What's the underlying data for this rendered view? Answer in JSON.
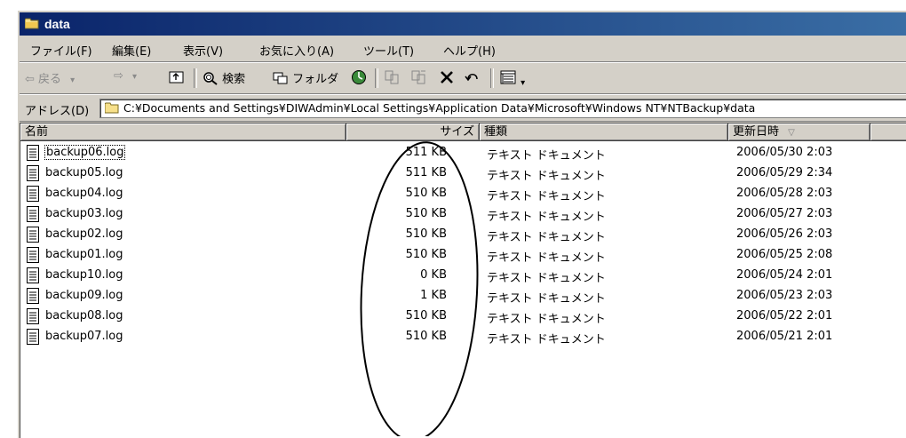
{
  "window": {
    "title": "data"
  },
  "menu": [
    {
      "label": "ファイル(F)"
    },
    {
      "label": "編集(E)"
    },
    {
      "label": "表示(V)"
    },
    {
      "label": "お気に入り(A)"
    },
    {
      "label": "ツール(T)"
    },
    {
      "label": "ヘルプ(H)"
    }
  ],
  "toolbar": {
    "back": "⇦ 戻る",
    "back_arrow": "▾",
    "forward": "⇨",
    "forward_arrow": "▾",
    "search": "検索",
    "folders": "フォルダ",
    "views_arrow": "▾"
  },
  "address": {
    "label": "アドレス(D)",
    "path": "C:¥Documents and Settings¥DIWAdmin¥Local Settings¥Application Data¥Microsoft¥Windows NT¥NTBackup¥data"
  },
  "columns": {
    "name": "名前",
    "size": "サイズ",
    "type": "種類",
    "modified": "更新日時",
    "sort_indicator": "▽"
  },
  "files": [
    {
      "name": "backup06.log",
      "size": "511 KB",
      "type": "テキスト ドキュメント",
      "modified": "2006/05/30 2:03"
    },
    {
      "name": "backup05.log",
      "size": "511 KB",
      "type": "テキスト ドキュメント",
      "modified": "2006/05/29 2:34"
    },
    {
      "name": "backup04.log",
      "size": "510 KB",
      "type": "テキスト ドキュメント",
      "modified": "2006/05/28 2:03"
    },
    {
      "name": "backup03.log",
      "size": "510 KB",
      "type": "テキスト ドキュメント",
      "modified": "2006/05/27 2:03"
    },
    {
      "name": "backup02.log",
      "size": "510 KB",
      "type": "テキスト ドキュメント",
      "modified": "2006/05/26 2:03"
    },
    {
      "name": "backup01.log",
      "size": "510 KB",
      "type": "テキスト ドキュメント",
      "modified": "2006/05/25 2:08"
    },
    {
      "name": "backup10.log",
      "size": "0 KB",
      "type": "テキスト ドキュメント",
      "modified": "2006/05/24 2:01"
    },
    {
      "name": "backup09.log",
      "size": "1 KB",
      "type": "テキスト ドキュメント",
      "modified": "2006/05/23 2:03"
    },
    {
      "name": "backup08.log",
      "size": "510 KB",
      "type": "テキスト ドキュメント",
      "modified": "2006/05/22 2:01"
    },
    {
      "name": "backup07.log",
      "size": "510 KB",
      "type": "テキスト ドキュメント",
      "modified": "2006/05/21 2:01"
    }
  ],
  "colors": {
    "titlebar_start": "#0a246a",
    "titlebar_end": "#3a6ea5",
    "chrome": "#d4d0c8",
    "annotation": "#000000"
  }
}
